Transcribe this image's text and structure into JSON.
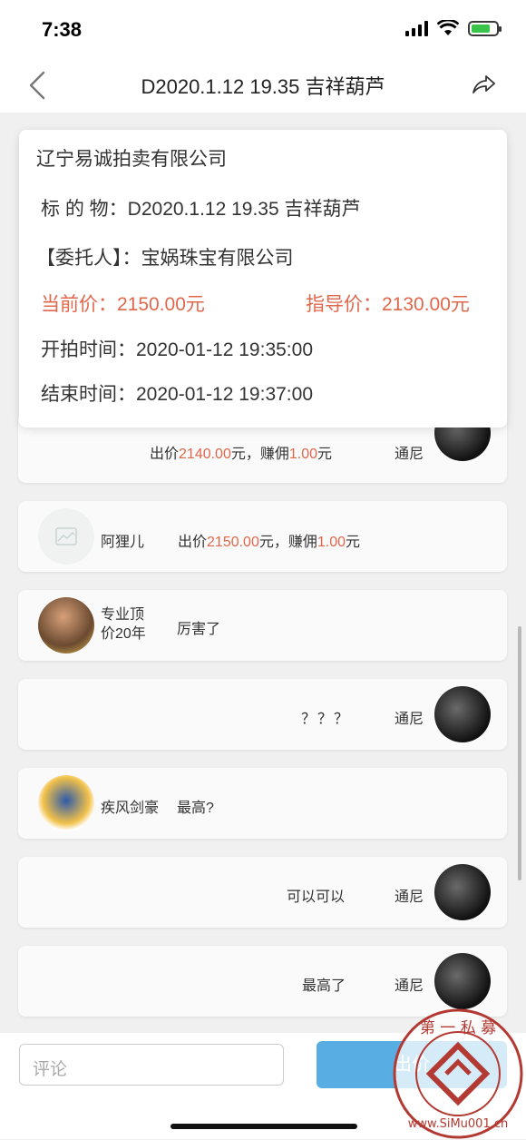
{
  "status": {
    "time": "7:38"
  },
  "nav": {
    "title": "D2020.1.12 19.35 吉祥葫芦"
  },
  "auction": {
    "company": "辽宁易诚拍卖有限公司",
    "lot_label": "标 的 物：",
    "lot_value": "D2020.1.12 19.35 吉祥葫芦",
    "consignor_label": "【委托人】：",
    "consignor_value": "宝娲珠宝有限公司",
    "current_price_label": "当前价：",
    "current_price_value": "2150.00元",
    "guide_price_label": "指导价：",
    "guide_price_value": "2130.00元",
    "start_label": "开拍时间：",
    "start_value": "2020-01-12 19:35:00",
    "end_label": "结束时间：",
    "end_value": "2020-01-12 19:37:00"
  },
  "messages": [
    {
      "name": "通尼",
      "bid_prefix": "出价",
      "bid_amount": "2140.00",
      "bid_mid": "元，赚佣",
      "commission": "1.00",
      "bid_suffix": "元"
    },
    {
      "name": "阿狸儿",
      "bid_prefix": "出价",
      "bid_amount": "2150.00",
      "bid_mid": "元，赚佣",
      "commission": "1.00",
      "bid_suffix": "元"
    },
    {
      "name_line1": "专业顶",
      "name_line2": "价20年",
      "text": "厉害了"
    },
    {
      "name": "通尼",
      "text": "？？？"
    },
    {
      "name": "疾风剑豪",
      "text": "最高?"
    },
    {
      "name": "通尼",
      "text": "可以可以"
    },
    {
      "name": "通尼",
      "text": "最高了"
    }
  ],
  "bottom": {
    "comment_placeholder": "评论",
    "send_label": "出价"
  },
  "watermark": {
    "text": "第一私募 www.SiMu001.cn"
  },
  "colors": {
    "accent": "#58aee3",
    "price_red": "#e0674c"
  }
}
